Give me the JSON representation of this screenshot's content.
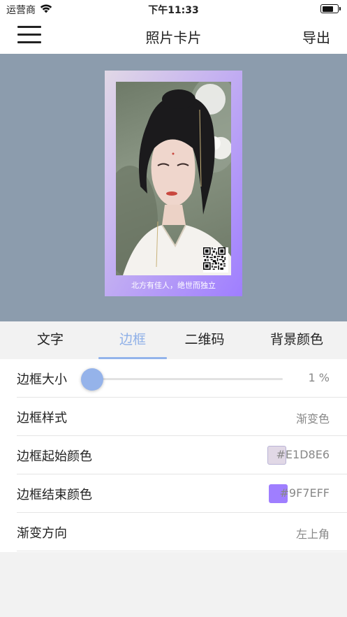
{
  "status_bar": {
    "carrier": "运营商",
    "time": "下午11:33",
    "battery_level": 0.75
  },
  "nav": {
    "title": "照片卡片",
    "export_label": "导出",
    "menu_icon": "hamburger-menu-icon"
  },
  "card": {
    "caption": "北方有佳人，绝世而独立",
    "border_start_color": "#E1D8E6",
    "border_end_color": "#9F7EFF",
    "gradient_direction": "左上角",
    "border_size_percent": 1
  },
  "tabs": [
    {
      "label": "文字",
      "active": false
    },
    {
      "label": "边框",
      "active": true
    },
    {
      "label": "二维码",
      "active": false
    },
    {
      "label": "背景颜色",
      "active": false
    }
  ],
  "settings": {
    "border_size": {
      "label": "边框大小",
      "value": "1 %"
    },
    "border_style": {
      "label": "边框样式",
      "value": "渐变色"
    },
    "start_color": {
      "label": "边框起始颜色",
      "value": "#E1D8E6"
    },
    "end_color": {
      "label": "边框结束颜色",
      "value": "#9F7EFF"
    },
    "gradient_direction": {
      "label": "渐变方向",
      "value": "左上角"
    }
  },
  "colors": {
    "accent": "#8fb0e8",
    "preview_background": "#8c9cad",
    "slider_thumb": "#95b3ea"
  }
}
